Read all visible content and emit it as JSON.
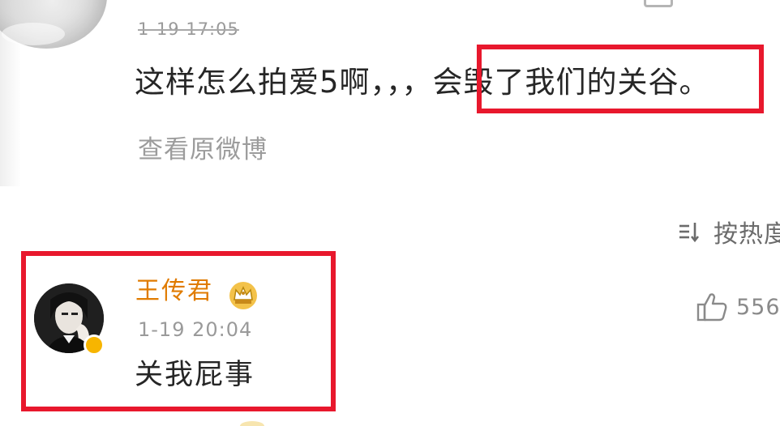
{
  "post": {
    "time": "1-19 17:05",
    "comment_text": "这样怎么拍爱5啊，，，会毁了我们的关谷。",
    "view_original_label": "查看原微博"
  },
  "sort": {
    "icon": "sort-icon",
    "label": "按热度"
  },
  "reply": {
    "username": "王传君",
    "badge_icon": "crown-badge-icon",
    "time": "1-19 20:04",
    "text": "关我屁事",
    "like_icon": "thumbs-up-icon",
    "like_count": "556"
  },
  "colors": {
    "highlight": "#e8182d",
    "username": "#e07b00",
    "badge": "#f7b500",
    "secondary_text": "#9a9a9a",
    "primary_text": "#262626"
  }
}
